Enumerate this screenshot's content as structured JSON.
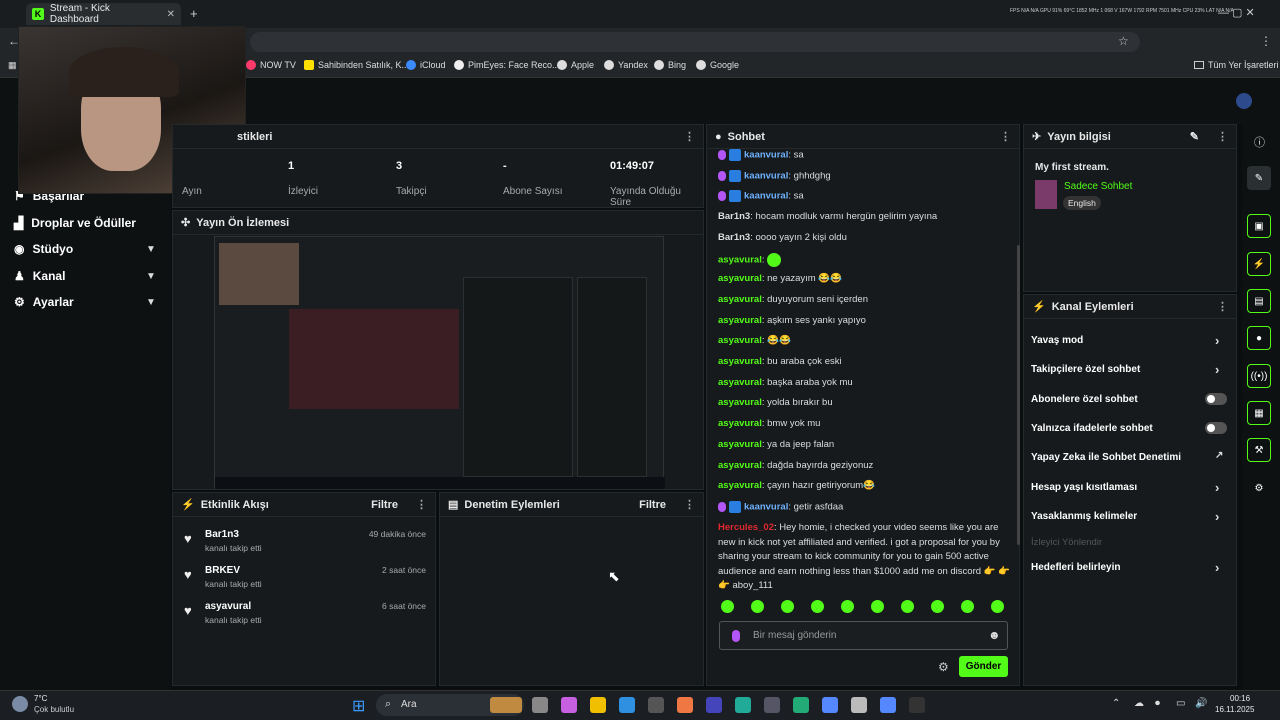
{
  "browser": {
    "tab_title": "Stream - Kick Dashboard",
    "new_tab": "+",
    "sys_readout": "FPS N/A N/A  GPU 91% 69°C 1852 MHz 1 068 V 167W 1792 RPM 7501 MHz  CPU 23%  LAT N/A N/A"
  },
  "bookmarks": [
    "NOW TV",
    "Sahibinden Satılık, K...",
    "iCloud",
    "PimEyes: Face Reco...",
    "Apple",
    "Yandex",
    "Bing",
    "Google"
  ],
  "bookmarks_all": "Tüm Yer İşaretleri",
  "sidebar": {
    "items": [
      {
        "label": "Başarılar"
      },
      {
        "label": "Droplar ve Ödüller"
      },
      {
        "label": "Stüdyo"
      },
      {
        "label": "Kanal"
      },
      {
        "label": "Ayarlar"
      }
    ]
  },
  "stats": {
    "title_partial": "stikleri",
    "partial_label": "Ayın",
    "items": [
      {
        "value": "1",
        "label": "İzleyici"
      },
      {
        "value": "3",
        "label": "Takipçi"
      },
      {
        "value": "-",
        "label": "Abone Sayısı"
      },
      {
        "value": "01:49:07",
        "label": "Yayında Olduğu Süre"
      }
    ]
  },
  "preview": {
    "title": "Yayın Ön İzlemesi"
  },
  "activity": {
    "title": "Etkinlik Akışı",
    "filter": "Filtre",
    "events": [
      {
        "name": "Bar1n3",
        "sub": "kanalı takip etti",
        "time": "49 dakika önce"
      },
      {
        "name": "BRKEV",
        "sub": "kanalı takip etti",
        "time": "2 saat önce"
      },
      {
        "name": "asyavural",
        "sub": "kanalı takip etti",
        "time": "6 saat önce"
      }
    ]
  },
  "moderation": {
    "title": "Denetim Eylemleri",
    "filter": "Filtre"
  },
  "chat": {
    "title": "Sohbet",
    "send": "Gönder",
    "placeholder": "Bir mesaj gönderin",
    "messages": [
      {
        "user": "kaanvural",
        "text": "sa",
        "style": "b"
      },
      {
        "user": "kaanvural",
        "text": "ghhdghg",
        "style": "b"
      },
      {
        "user": "kaanvural",
        "text": "sa",
        "style": "b"
      },
      {
        "user": "Bar1n3",
        "text": "hocam modluk varmı hergün gelirim yayına",
        "style": "w"
      },
      {
        "user": "Bar1n3",
        "text": "oooo yayın 2 kişi oldu",
        "style": "w"
      },
      {
        "user": "asyavural",
        "text": "",
        "style": "g"
      },
      {
        "user": "asyavural",
        "text": "ne yazayım 😂😂",
        "style": "g"
      },
      {
        "user": "asyavural",
        "text": "duyuyorum seni içerden",
        "style": "g"
      },
      {
        "user": "asyavural",
        "text": "aşkım ses yankı yapıyo",
        "style": "g"
      },
      {
        "user": "asyavural",
        "text": "😂😂",
        "style": "g"
      },
      {
        "user": "asyavural",
        "text": "bu araba çok eski",
        "style": "g"
      },
      {
        "user": "asyavural",
        "text": "başka araba yok mu",
        "style": "g"
      },
      {
        "user": "asyavural",
        "text": "yolda bırakır bu",
        "style": "g"
      },
      {
        "user": "asyavural",
        "text": "bmw yok mu",
        "style": "g"
      },
      {
        "user": "asyavural",
        "text": "ya da jeep falan",
        "style": "g"
      },
      {
        "user": "asyavural",
        "text": "dağda bayırda geziyonuz",
        "style": "g"
      },
      {
        "user": "asyavural",
        "text": "çayın hazır getiriyorum😂",
        "style": "g"
      },
      {
        "user": "kaanvural",
        "text": "getir asfdaa",
        "style": "b"
      }
    ],
    "long_msg": {
      "user": "Hercules_02",
      "lines": [
        "Hey homie, i checked your video seems like you are",
        "new in kick not yet affiliated and verified. i got a proposal for you by",
        "sharing your stream to kick community for you to gain 500 active",
        "audience and earn nothing less than $1000 add me on discord 👉 👉",
        "👉 aboy_111"
      ]
    }
  },
  "info": {
    "title": "Yayın bilgisi",
    "stream_title": "My first stream.",
    "category": "Sadece Sohbet",
    "language": "English"
  },
  "channel": {
    "title": "Kanal Eylemleri",
    "items": [
      {
        "label": "Yavaş mod",
        "control": "arrow"
      },
      {
        "label": "Takipçilere özel sohbet",
        "control": "arrow"
      },
      {
        "label": "Abonelere özel sohbet",
        "control": "toggle"
      },
      {
        "label": "Yalnızca ifadelerle sohbet",
        "control": "toggle"
      },
      {
        "label": "Yapay Zeka ile Sohbet Denetimi",
        "control": "ext"
      },
      {
        "label": "Hesap yaşı kısıtlaması",
        "control": "arrow"
      },
      {
        "label": "Yasaklanmış kelimeler",
        "control": "arrow"
      },
      {
        "label": "İzleyici Yönlendir",
        "control": "none"
      },
      {
        "label": "Hedefleri belirleyin",
        "control": "arrow"
      }
    ]
  },
  "taskbar": {
    "weather_temp": "7°C",
    "weather_desc": "Çok bulutlu",
    "search": "Ara",
    "time": "00:16",
    "date": "16.11.2025"
  },
  "colors": {
    "accent": "#53fc18",
    "bg": "#0b0e0f",
    "panel": "#161a1c"
  }
}
